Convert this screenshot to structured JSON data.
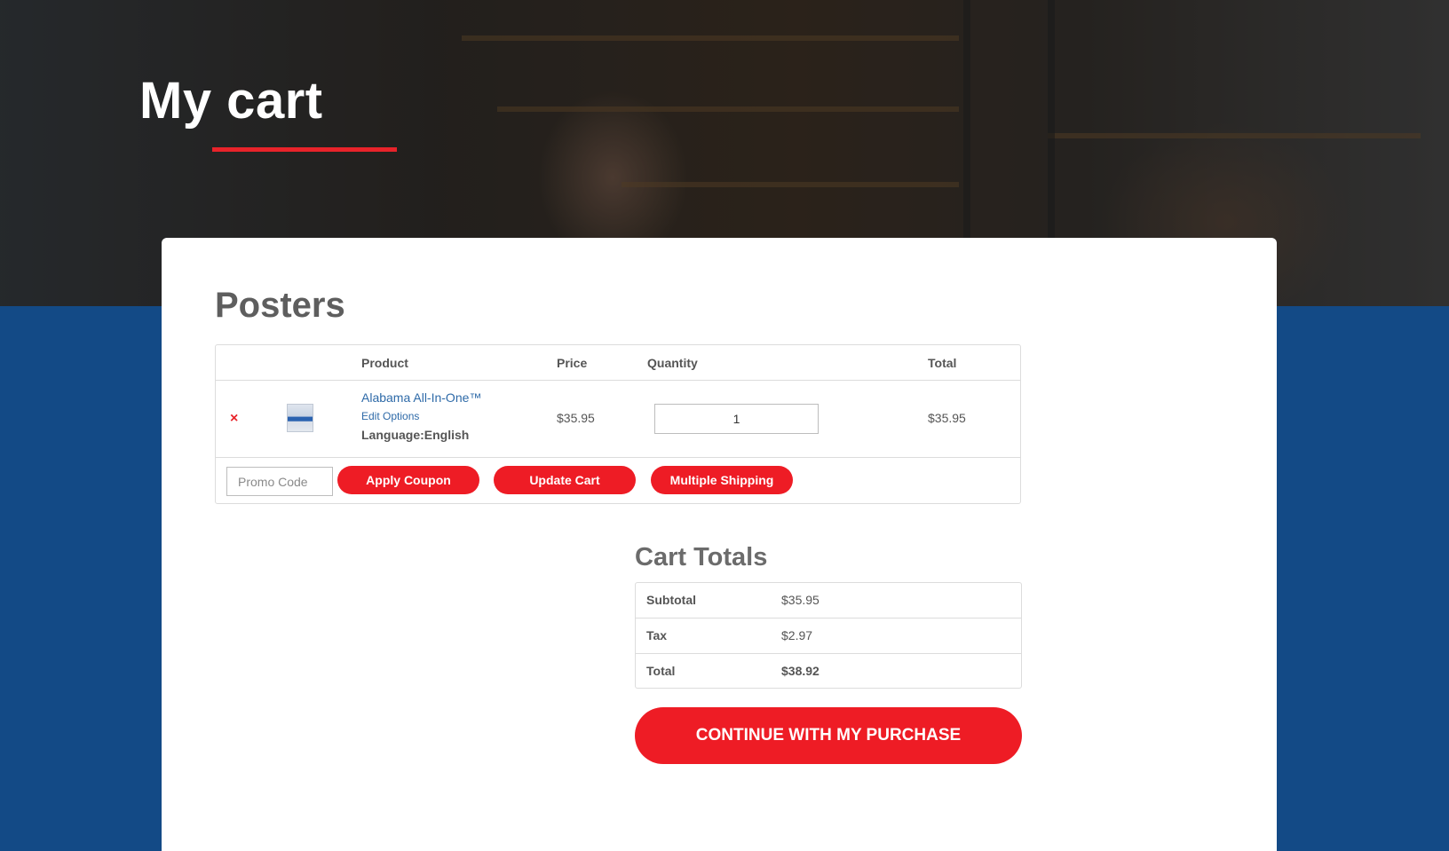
{
  "hero": {
    "title": "My cart"
  },
  "cart": {
    "section_title": "Posters",
    "columns": {
      "product": "Product",
      "price": "Price",
      "quantity": "Quantity",
      "total": "Total"
    },
    "items": [
      {
        "remove_icon": "×",
        "thumbnail_icon": "poster-thumbnail",
        "name": "Alabama All-In-One™",
        "edit_label": "Edit Options",
        "option": "Language:English",
        "price": "$35.95",
        "quantity": "1",
        "total": "$35.95"
      }
    ],
    "promo_placeholder": "Promo Code",
    "apply_coupon_label": "Apply Coupon",
    "update_cart_label": "Update Cart",
    "multiple_shipping_label": "Multiple Shipping"
  },
  "totals": {
    "title": "Cart Totals",
    "rows": [
      {
        "label": "Subtotal",
        "value": "$35.95"
      },
      {
        "label": "Tax",
        "value": "$2.97"
      },
      {
        "label": "Total",
        "value": "$38.92"
      }
    ],
    "continue_label": "CONTINUE WITH MY PURCHASE"
  },
  "colors": {
    "accent_red": "#ee1c25",
    "background_blue": "#134a86",
    "link_blue": "#2e6aa8"
  }
}
